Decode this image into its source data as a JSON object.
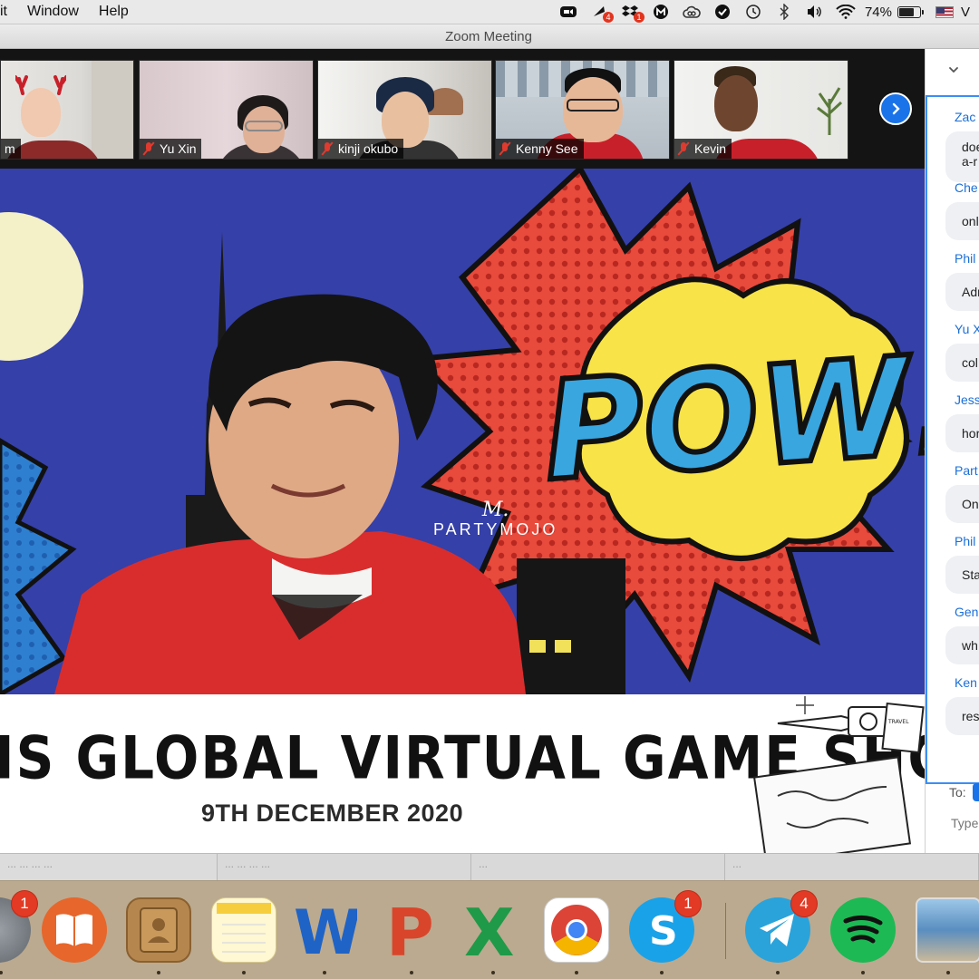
{
  "menubar": {
    "items": [
      "it",
      "Window",
      "Help"
    ],
    "tray_icons": [
      {
        "icon": "zoom-icon"
      },
      {
        "icon": "notification-icon",
        "badge": "4"
      },
      {
        "icon": "dropbox-icon",
        "badge": "1"
      },
      {
        "icon": "m-app-icon"
      },
      {
        "icon": "creative-cloud-icon"
      },
      {
        "icon": "checkmark-shield-icon"
      },
      {
        "icon": "time-machine-icon"
      },
      {
        "icon": "bluetooth-icon"
      },
      {
        "icon": "volume-icon"
      },
      {
        "icon": "wifi-icon"
      }
    ],
    "battery_percent": "74%",
    "battery_level": 0.74,
    "tail_text": "V"
  },
  "window": {
    "title": "Zoom Meeting"
  },
  "participants": [
    {
      "name": "m"
    },
    {
      "name": "Yu Xin"
    },
    {
      "name": "kinji okubo"
    },
    {
      "name": "Kenny See"
    },
    {
      "name": "Kevin"
    }
  ],
  "main_video": {
    "pow_text": "POW!",
    "logo_mark": "M.",
    "logo_text": "PARTYMOJO"
  },
  "banner": {
    "title": "IS GLOBAL VIRTUAL GAME SHOW",
    "date": "9TH DECEMBER 2020",
    "stamp_text": "TRAVEL AROUND THE WORLD"
  },
  "chat": {
    "messages": [
      {
        "sender": "Zac",
        "text": "doe",
        "text2": "a-r"
      },
      {
        "sender": "Che",
        "text": "onl"
      },
      {
        "sender": "Phil",
        "text": "Adr"
      },
      {
        "sender": "Yu X",
        "text": "col"
      },
      {
        "sender": "Jess",
        "text": "hor"
      },
      {
        "sender": "Part",
        "text": "On"
      },
      {
        "sender": "Phil",
        "text": "Sta"
      },
      {
        "sender": "Gen",
        "text": "wh"
      },
      {
        "sender": "Ken",
        "text": "res"
      }
    ],
    "to_label": "To:",
    "input_placeholder": "Type"
  },
  "background_windows": [
    "... ... ... ...",
    "... ... ... ...",
    "...",
    "..."
  ],
  "dock": {
    "apps": [
      {
        "icon": "system-preferences-icon",
        "badge": "1"
      },
      {
        "icon": "books-icon"
      },
      {
        "icon": "contacts-icon"
      },
      {
        "icon": "notes-icon"
      },
      {
        "icon": "word-icon"
      },
      {
        "icon": "powerpoint-icon"
      },
      {
        "icon": "excel-icon"
      },
      {
        "icon": "chrome-icon"
      },
      {
        "icon": "skype-icon",
        "badge": "1"
      },
      {
        "icon": "telegram-icon",
        "badge": "4"
      },
      {
        "icon": "spotify-icon"
      },
      {
        "icon": "preview-icon"
      }
    ]
  }
}
